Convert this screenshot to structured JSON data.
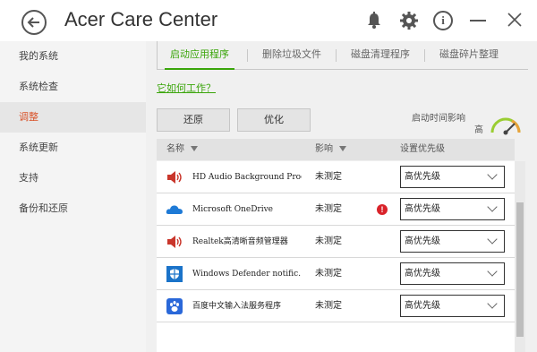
{
  "app": {
    "title": "Acer Care Center"
  },
  "sidebar": {
    "items": [
      {
        "label": "我的系统",
        "active": false
      },
      {
        "label": "系统检查",
        "active": false
      },
      {
        "label": "调整",
        "active": true
      },
      {
        "label": "系统更新",
        "active": false
      },
      {
        "label": "支持",
        "active": false
      },
      {
        "label": "备份和还原",
        "active": false
      }
    ]
  },
  "tabs": [
    {
      "label": "启动应用程序",
      "active": true
    },
    {
      "label": "删除垃圾文件",
      "active": false
    },
    {
      "label": "磁盘清理程序",
      "active": false
    },
    {
      "label": "磁盘碎片整理",
      "active": false
    }
  ],
  "how_link": "它如何工作？",
  "buttons": {
    "restore": "还原",
    "optimize": "优化"
  },
  "startup": {
    "label": "启动时间影响",
    "value": "高"
  },
  "table": {
    "headers": {
      "name": "名称",
      "impact": "影响",
      "priority": "设置优先级"
    },
    "rows": [
      {
        "icon": "speaker-icon",
        "name": "HD Audio Background Proc…",
        "impact": "未测定",
        "warning": false,
        "priority": "高优先级"
      },
      {
        "icon": "onedrive-icon",
        "name": "Microsoft OneDrive",
        "impact": "未测定",
        "warning": true,
        "priority": "高优先级"
      },
      {
        "icon": "speaker-icon",
        "name": "Realtek高清晰音频管理器",
        "impact": "未测定",
        "warning": false,
        "priority": "高优先级"
      },
      {
        "icon": "defender-icon",
        "name": "Windows Defender notific…",
        "impact": "未测定",
        "warning": false,
        "priority": "高优先级"
      },
      {
        "icon": "paw-icon",
        "name": "百度中文输入法服务程序",
        "impact": "未测定",
        "warning": false,
        "priority": "高优先级"
      }
    ]
  },
  "colors": {
    "accent": "#3aa50a",
    "active_side": "#d9532a",
    "warning": "#d9232a"
  }
}
